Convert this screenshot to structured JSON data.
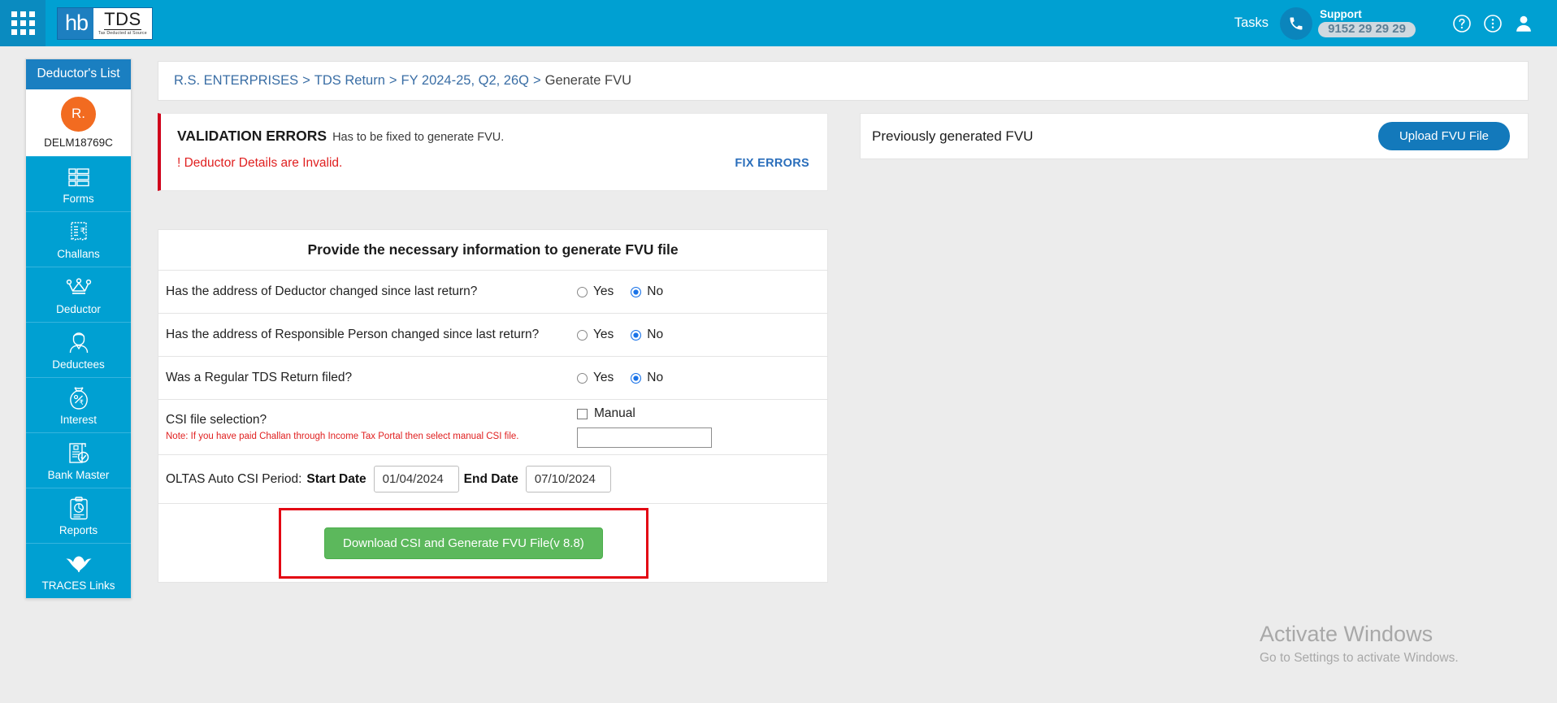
{
  "header": {
    "apps_icon": "apps-grid-icon",
    "logo": {
      "hb": "hb",
      "tds": "TDS",
      "tagline": "Tax Deducted at Source"
    },
    "tasks_label": "Tasks",
    "support_label": "Support",
    "support_number": "9152 29 29 29",
    "phone_icon": "phone-icon",
    "help_icon": "help-circle-icon",
    "more_icon": "more-vertical-circle-icon",
    "account_icon": "user-avatar-icon",
    "accent_color": "#00a0d2"
  },
  "sidebar": {
    "title": "Deductor's List",
    "active": {
      "initial": "R.",
      "tan": "DELM18769C",
      "avatar_color": "#f26b20"
    },
    "items": [
      {
        "label": "Forms",
        "icon": "forms-icon"
      },
      {
        "label": "Challans",
        "icon": "challan-receipt-icon"
      },
      {
        "label": "Deductor",
        "icon": "crown-icon"
      },
      {
        "label": "Deductees",
        "icon": "person-icon"
      },
      {
        "label": "Interest",
        "icon": "money-bag-icon"
      },
      {
        "label": "Bank Master",
        "icon": "bank-document-icon"
      },
      {
        "label": "Reports",
        "icon": "report-clipboard-icon"
      },
      {
        "label": "TRACES Links",
        "icon": "traces-logo-icon"
      }
    ]
  },
  "breadcrumb": {
    "items": [
      {
        "label": "R.S. ENTERPRISES",
        "current": false
      },
      {
        "label": "TDS Return",
        "current": false
      },
      {
        "label": "FY 2024-25, Q2, 26Q",
        "current": false
      },
      {
        "label": "Generate FVU",
        "current": true
      }
    ],
    "separator": ">"
  },
  "validation": {
    "title": "VALIDATION ERRORS",
    "subtitle": "Has to be fixed to generate FVU.",
    "error": "! Deductor Details are Invalid.",
    "fix_link": "FIX ERRORS",
    "accent_color": "#d0021b"
  },
  "form": {
    "title": "Provide the necessary information to generate FVU file",
    "rows": [
      {
        "label": "Has the address of Deductor changed since last return?",
        "yes_label": "Yes",
        "no_label": "No",
        "selected": "No"
      },
      {
        "label": "Has the address of Responsible Person changed since last return?",
        "yes_label": "Yes",
        "no_label": "No",
        "selected": "No"
      },
      {
        "label": "Was a Regular TDS Return filed?",
        "yes_label": "Yes",
        "no_label": "No",
        "selected": "No"
      }
    ],
    "csi": {
      "label": "CSI file selection?",
      "note": "Note: If you have paid Challan through Income Tax Portal then select manual CSI file.",
      "manual_label": "Manual",
      "manual_checked": false,
      "manual_value": "",
      "manual_placeholder": ""
    },
    "oltas": {
      "label": "OLTAS Auto CSI Period:",
      "start_label": "Start Date",
      "start_value": "01/04/2024",
      "end_label": "End Date",
      "end_value": "07/10/2024"
    },
    "submit_label": "Download CSI and Generate FVU File(v 8.8)",
    "submit_color": "#5cb85c",
    "highlight_color": "#e30613"
  },
  "right_panel": {
    "title": "Previously generated FVU",
    "upload_label": "Upload FVU File",
    "upload_color": "#1379bb"
  },
  "watermark": {
    "title": "Activate Windows",
    "subtitle": "Go to Settings to activate Windows."
  }
}
